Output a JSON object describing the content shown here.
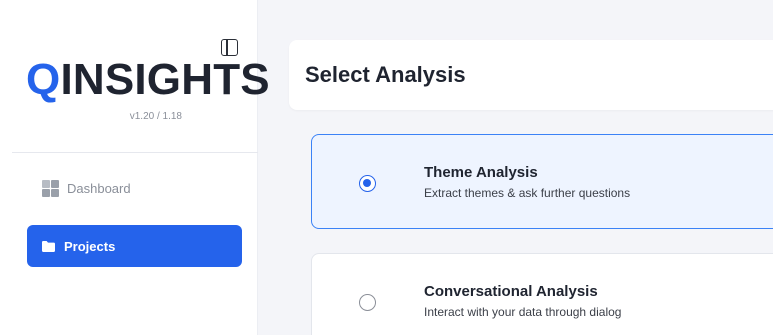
{
  "sidebar": {
    "logo_q": "Q",
    "logo_rest": "INSIGHTS",
    "version": "v1.20 / 1.18",
    "items": [
      {
        "label": "Dashboard"
      },
      {
        "label": "Projects"
      }
    ]
  },
  "main": {
    "title": "Select Analysis",
    "options": [
      {
        "title": "Theme Analysis",
        "description": "Extract themes & ask further questions",
        "selected": true
      },
      {
        "title": "Conversational Analysis",
        "description": "Interact with your data through dialog",
        "selected": false
      }
    ]
  },
  "colors": {
    "accent": "#2563eb",
    "selected_bg": "#eef4ff",
    "background": "#f4f5f9"
  }
}
